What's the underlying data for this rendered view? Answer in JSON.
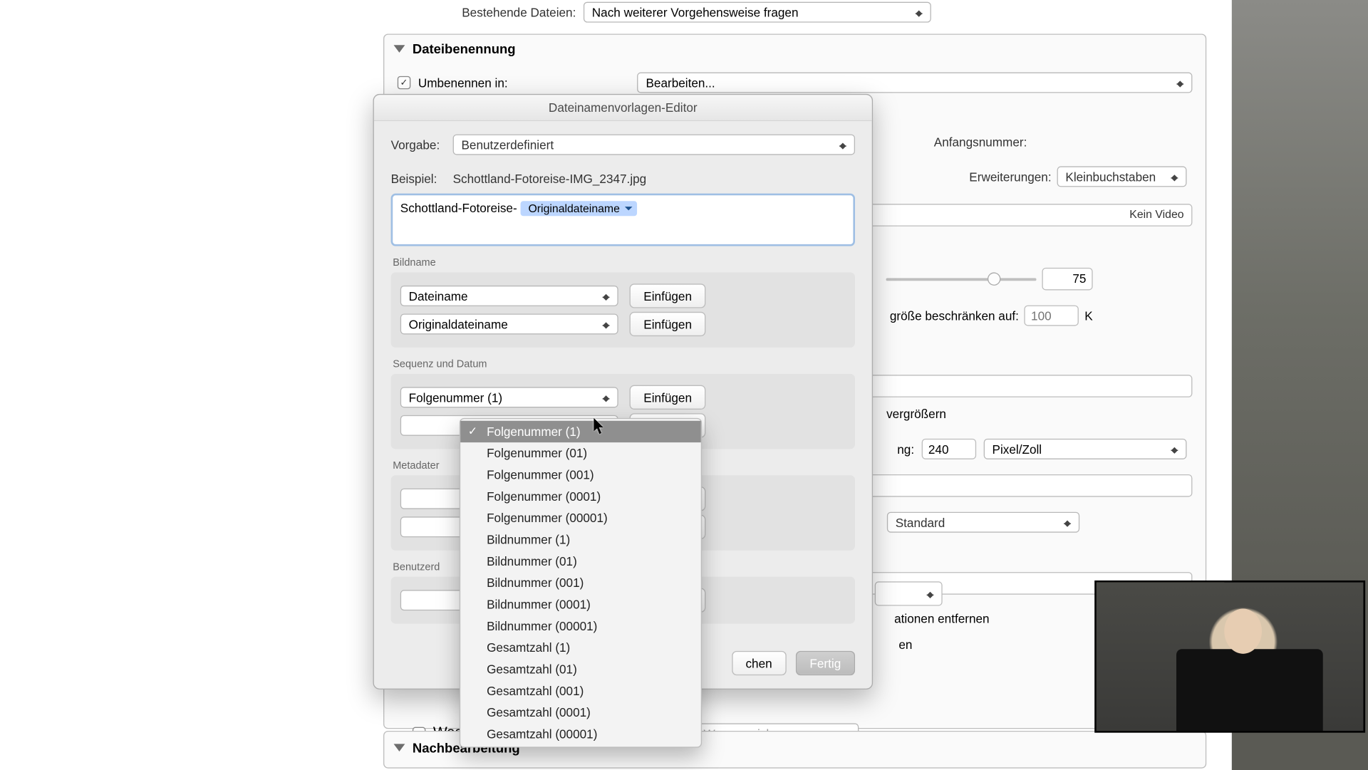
{
  "topbar": {
    "existing_label": "Bestehende Dateien:",
    "existing_value": "Nach weiterer Vorgehensweise fragen"
  },
  "naming_section": {
    "title": "Dateibenennung",
    "rename_label": "Umbenennen in:",
    "rename_value": "Bearbeiten...",
    "start_label": "Anfangsnummer:",
    "ext_label": "Erweiterungen:",
    "ext_value": "Kleinbuchstaben",
    "no_video": "Kein Video",
    "quality_value": "75",
    "limit_label": "größe beschränken auf:",
    "limit_placeholder": "100",
    "limit_unit": "K",
    "resize_label": "vergrößern",
    "res_suffix": "ng:",
    "res_value": "240",
    "res_unit": "Pixel/Zoll",
    "sharp_value": "Standard",
    "remove_info": "ationen entfernen",
    "remove_tail": "en",
    "watermark_label": "Wasserzeichen:",
    "watermark_value": "Einf. Copyright-Wasserzeichen"
  },
  "post_section": {
    "title": "Nachbearbeitung"
  },
  "dialog": {
    "title": "Dateinamenvorlagen-Editor",
    "preset_label": "Vorgabe:",
    "preset_value": "Benutzerdefiniert",
    "example_label": "Beispiel:",
    "example_value": "Schottland-Fotoreise-IMG_2347.jpg",
    "token_prefix": "Schottland-Fotoreise-",
    "token_name": "Originaldateiname",
    "groups": {
      "bildname": {
        "label": "Bildname",
        "row1": "Dateiname",
        "row2": "Originaldateiname"
      },
      "sequenz": {
        "label": "Sequenz und Datum",
        "row1": "Folgenummer (1)"
      },
      "metadaten": {
        "label": "Metadater"
      },
      "benutzer": {
        "label": "Benutzerd"
      }
    },
    "insert": "Einfügen",
    "cancel": "chen",
    "done": "Fertig"
  },
  "menu": {
    "items": [
      "Folgenummer (1)",
      "Folgenummer (01)",
      "Folgenummer (001)",
      "Folgenummer (0001)",
      "Folgenummer (00001)",
      "Bildnummer (1)",
      "Bildnummer (01)",
      "Bildnummer (001)",
      "Bildnummer (0001)",
      "Bildnummer (00001)",
      "Gesamtzahl (1)",
      "Gesamtzahl (01)",
      "Gesamtzahl (001)",
      "Gesamtzahl (0001)",
      "Gesamtzahl (00001)"
    ]
  }
}
